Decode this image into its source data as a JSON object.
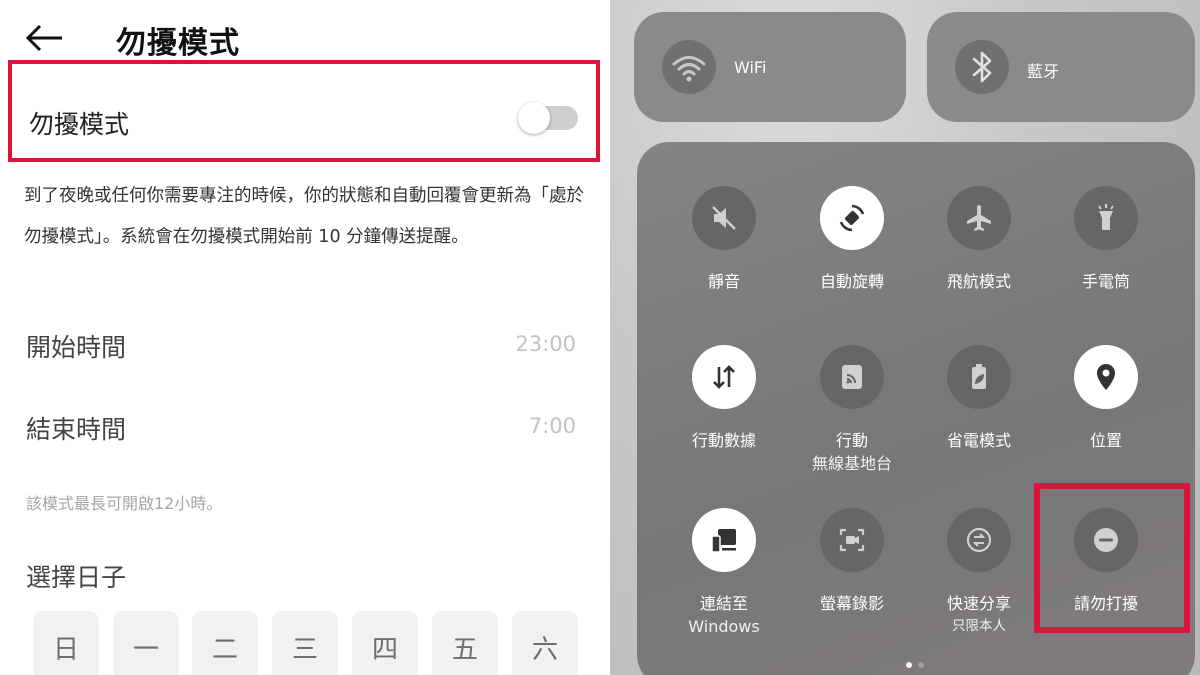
{
  "left": {
    "title": "勿擾模式",
    "toggle_label": "勿擾模式",
    "toggle_state": "off",
    "description": "到了夜晚或任何你需要專注的時候，你的狀態和自動回覆會更新為「處於勿擾模式」。系統會在勿擾模式開始前 10 分鐘傳送提醒。",
    "start_label": "開始時間",
    "start_value": "23:00",
    "end_label": "結束時間",
    "end_value": "7:00",
    "note": "該模式最長可開啟12小時。",
    "select_days_label": "選擇日子",
    "days": [
      "日",
      "一",
      "二",
      "三",
      "四",
      "五",
      "六"
    ],
    "highlight_color": "#dc143c"
  },
  "right": {
    "wifi_label": "WiFi",
    "bluetooth_label": "藍牙",
    "tiles": [
      {
        "label": "靜音",
        "icon": "mute-icon",
        "active": false
      },
      {
        "label": "自動旋轉",
        "icon": "auto-rotate-icon",
        "active": true
      },
      {
        "label": "飛航模式",
        "icon": "airplane-icon",
        "active": false
      },
      {
        "label": "手電筒",
        "icon": "flashlight-icon",
        "active": false
      },
      {
        "label": "行動數據",
        "icon": "mobile-data-icon",
        "active": true
      },
      {
        "label": "行動",
        "sublabel": "無線基地台",
        "icon": "hotspot-icon",
        "active": false
      },
      {
        "label": "省電模式",
        "icon": "battery-saver-icon",
        "active": false
      },
      {
        "label": "位置",
        "icon": "location-icon",
        "active": true
      },
      {
        "label": "連結至",
        "sublabel": "Windows",
        "icon": "link-windows-icon",
        "active": true
      },
      {
        "label": "螢幕錄影",
        "icon": "screen-record-icon",
        "active": false
      },
      {
        "label": "快速分享",
        "sublabel": "只限本人",
        "icon": "quick-share-icon",
        "active": false
      },
      {
        "label": "請勿打擾",
        "icon": "do-not-disturb-icon",
        "active": false
      }
    ],
    "page_indicator": {
      "pages": 2,
      "current": 1
    }
  }
}
